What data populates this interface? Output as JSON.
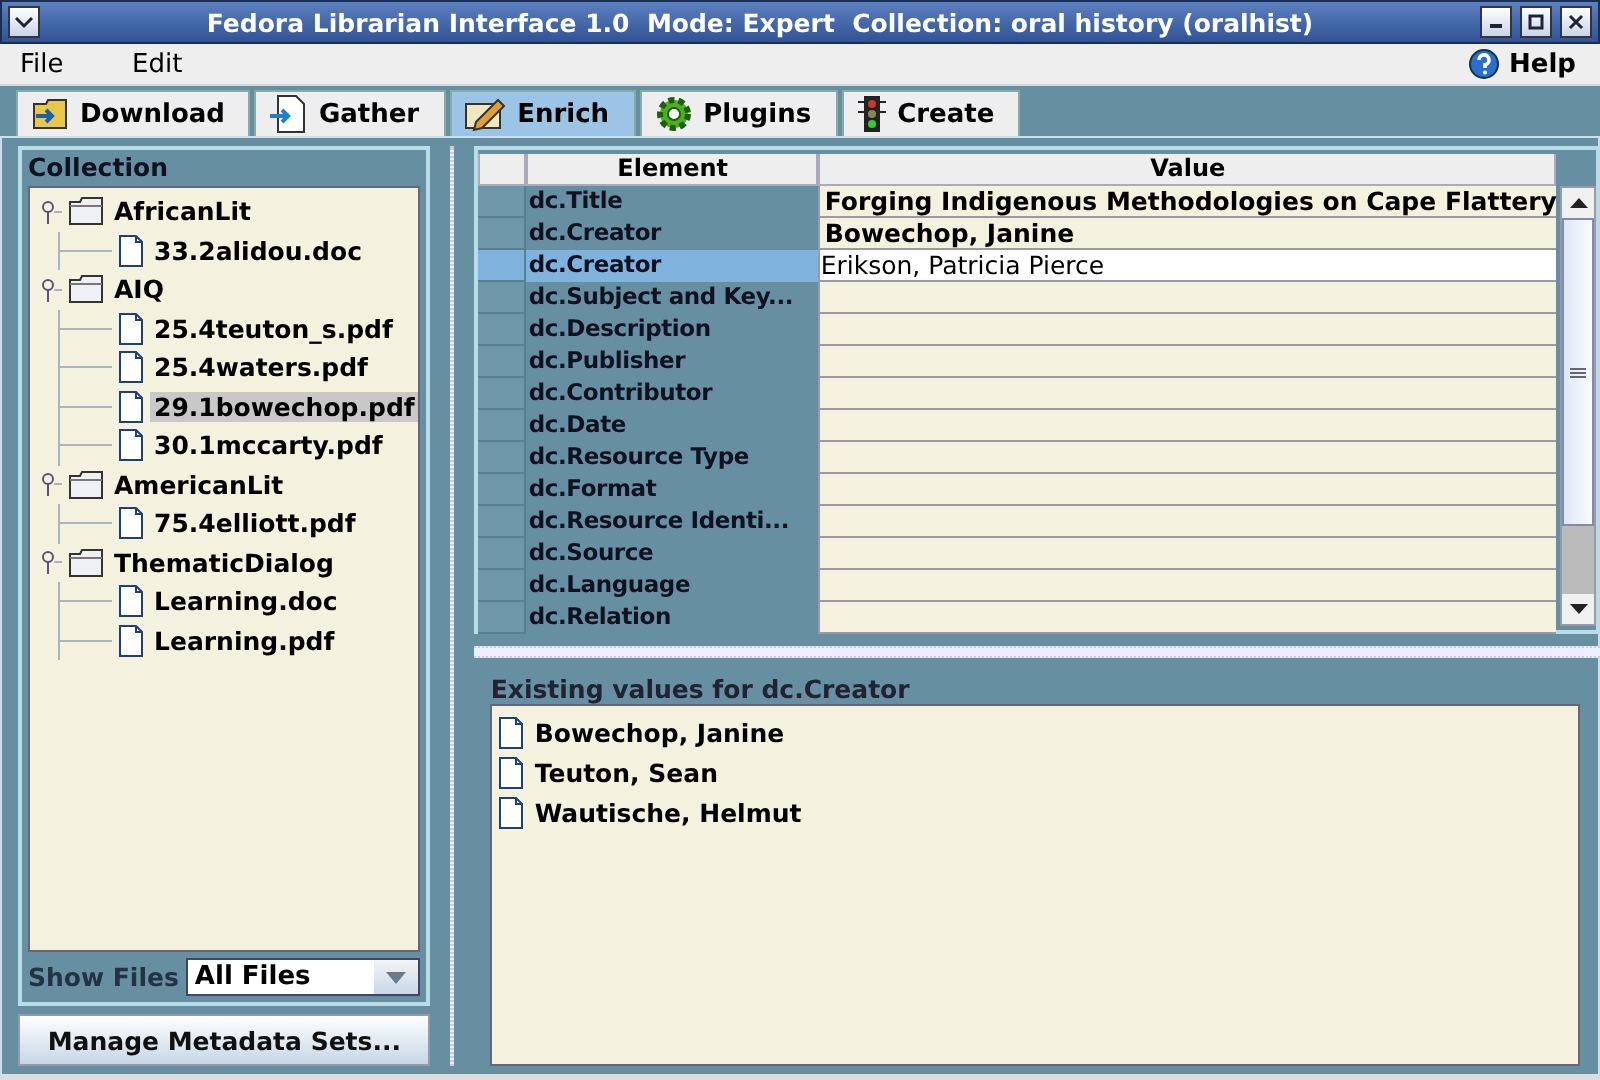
{
  "window": {
    "title": "Fedora Librarian Interface 1.0  Mode: Expert  Collection: oral history (oralhist)"
  },
  "menu": [
    {
      "label": "File"
    },
    {
      "label": "Edit"
    }
  ],
  "help": {
    "label": "Help"
  },
  "tabs": [
    {
      "label": "Download",
      "selected": false
    },
    {
      "label": "Gather",
      "selected": false
    },
    {
      "label": "Enrich",
      "selected": true
    },
    {
      "label": "Plugins",
      "selected": false
    },
    {
      "label": "Create",
      "selected": false
    }
  ],
  "collection": {
    "title": "Collection",
    "tree": [
      {
        "label": "AfricanLit",
        "expanded": true,
        "selected": false,
        "children": [
          {
            "label": "33.2alidou.doc",
            "selected": false
          }
        ]
      },
      {
        "label": "AIQ",
        "expanded": true,
        "selected": false,
        "children": [
          {
            "label": "25.4teuton_s.pdf",
            "selected": false
          },
          {
            "label": "25.4waters.pdf",
            "selected": false
          },
          {
            "label": "29.1bowechop.pdf",
            "selected": true
          },
          {
            "label": "30.1mccarty.pdf",
            "selected": false
          }
        ]
      },
      {
        "label": "AmericanLit",
        "expanded": true,
        "selected": false,
        "children": [
          {
            "label": "75.4elliott.pdf",
            "selected": false
          }
        ]
      },
      {
        "label": "ThematicDialog",
        "expanded": true,
        "selected": false,
        "children": [
          {
            "label": "Learning.doc",
            "selected": false
          },
          {
            "label": "Learning.pdf",
            "selected": false
          }
        ]
      }
    ]
  },
  "show_files": {
    "label": "Show Files",
    "value": "All Files"
  },
  "manage_button": {
    "label": "Manage Metadata Sets..."
  },
  "metadata_table": {
    "columns": [
      "Element",
      "Value"
    ],
    "rows": [
      {
        "element": "dc.Title",
        "value": "Forging Indigenous Methodologies on Cape Flattery",
        "selected": false
      },
      {
        "element": "dc.Creator",
        "value": "Bowechop, Janine",
        "selected": false
      },
      {
        "element": "dc.Creator",
        "value": "Erikson, Patricia Pierce",
        "selected": true
      },
      {
        "element": "dc.Subject and Key...",
        "selected": false
      },
      {
        "element": "dc.Description",
        "selected": false
      },
      {
        "element": "dc.Publisher",
        "selected": false
      },
      {
        "element": "dc.Contributor",
        "selected": false
      },
      {
        "element": "dc.Date",
        "selected": false
      },
      {
        "element": "dc.Resource Type",
        "selected": false
      },
      {
        "element": "dc.Format",
        "selected": false
      },
      {
        "element": "dc.Resource Identi...",
        "selected": false
      },
      {
        "element": "dc.Source",
        "selected": false
      },
      {
        "element": "dc.Language",
        "selected": false
      },
      {
        "element": "dc.Relation",
        "selected": false
      }
    ]
  },
  "existing_values": {
    "title": "Existing values for dc.Creator",
    "items": [
      {
        "label": "Bowechop, Janine"
      },
      {
        "label": "Teuton, Sean"
      },
      {
        "label": "Wautische, Helmut"
      }
    ]
  }
}
